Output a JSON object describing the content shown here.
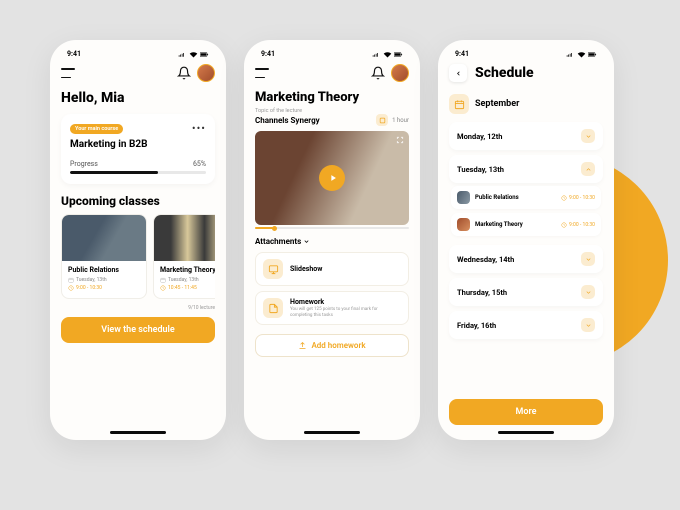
{
  "statusbar": {
    "time": "9:41"
  },
  "phone1": {
    "greeting": "Hello, Mia",
    "main_course": {
      "badge": "Your main course",
      "title": "Marketing in B2B",
      "progress_label": "Progress",
      "progress_value": "65%",
      "progress_pct": 65
    },
    "upcoming_title": "Upcoming classes",
    "classes": [
      {
        "title": "Public Relations",
        "date": "Tuesday, 13th",
        "time": "9:00 - 10:30"
      },
      {
        "title": "Marketing Theory",
        "date": "Tuesday, 13th",
        "time": "10:45 - 11:45"
      }
    ],
    "lecture_count": "9/10 lecture",
    "cta": "View the schedule"
  },
  "phone2": {
    "title": "Marketing Theory",
    "topic_label": "Topic of the lecture",
    "topic": "Channels Synergy",
    "duration": "1 hour",
    "attachments_title": "Attachments",
    "attachments": [
      {
        "title": "Slideshow",
        "sub": ""
      },
      {
        "title": "Homework",
        "sub": "You will get 125 points to your final mark for completing this tasks"
      }
    ],
    "add_btn": "Add homework"
  },
  "phone3": {
    "title": "Schedule",
    "month": "September",
    "days": [
      {
        "label": "Monday, 12th"
      },
      {
        "label": "Tuesday, 13th"
      },
      {
        "label": "Wednesday, 14th"
      },
      {
        "label": "Thursday, 15th"
      },
      {
        "label": "Friday, 16th"
      }
    ],
    "tuesday_items": [
      {
        "name": "Public Relations",
        "time": "9:00 - 10:30"
      },
      {
        "name": "Marketing Theory",
        "time": "9:00 - 10:30"
      }
    ],
    "more": "More"
  }
}
